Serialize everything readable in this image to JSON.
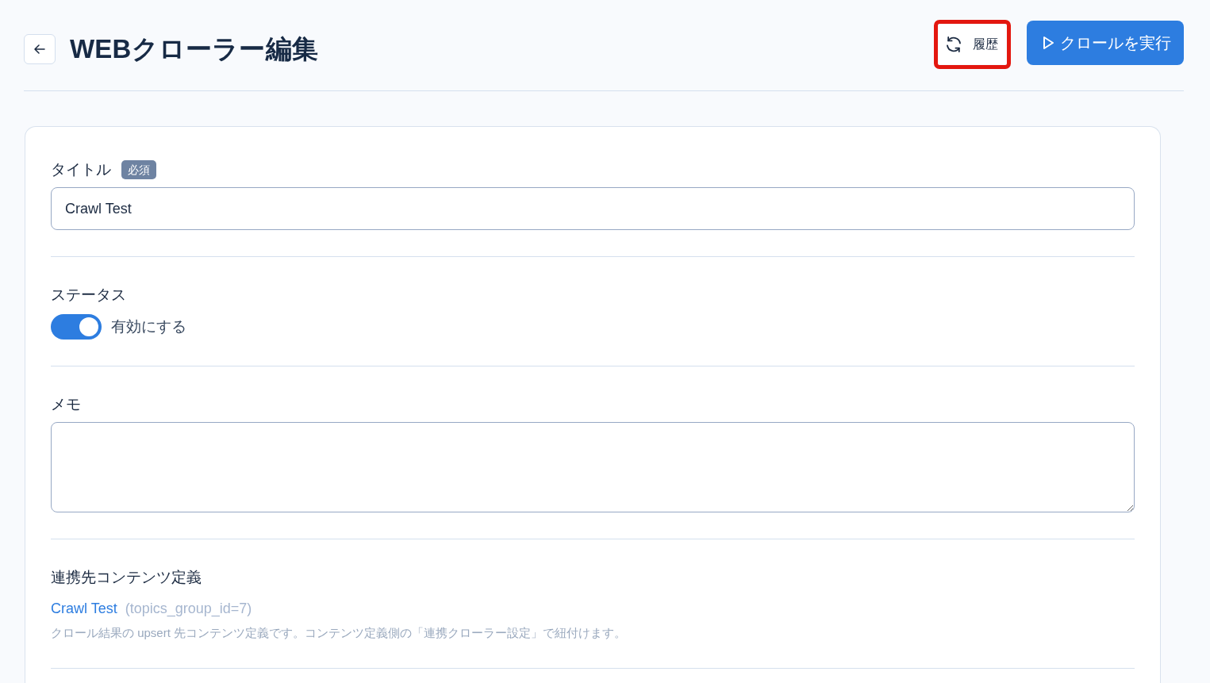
{
  "header": {
    "title": "WEBクローラー編集",
    "buttons": [
      {
        "kind": "history",
        "label": "履歴",
        "highlighted": true
      },
      {
        "kind": "run",
        "label": "クロールを実行",
        "highlighted": false
      }
    ]
  },
  "form": {
    "fields": [
      {
        "kind": "text",
        "label": "タイトル",
        "badge": "必須",
        "value": "Crawl Test"
      },
      {
        "kind": "switch",
        "label": "ステータス",
        "switch_label": "有効にする",
        "on": true
      },
      {
        "kind": "textarea",
        "label": "メモ"
      },
      {
        "kind": "link",
        "label": "連携先コンテンツ定義",
        "link_text": "Crawl Test",
        "detail": "(topics_group_id=7)",
        "help": "クロール結果の upsert 先コンテンツ定義です。コンテンツ定義側の「連携クローラー設定」で紐付けます。"
      }
    ]
  }
}
